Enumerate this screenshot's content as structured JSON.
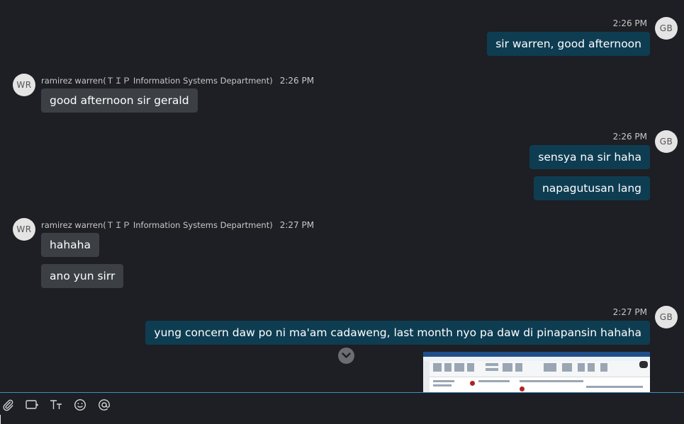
{
  "messages": [
    {
      "sender_initials": "GB",
      "time": "2:26 PM",
      "bubbles": [
        "sir warren, good afternoon"
      ]
    },
    {
      "sender_initials": "WR",
      "sender_name": "ramirez warren(ＴＩＰ Information Systems Department)",
      "time": "2:26 PM",
      "bubbles": [
        "good afternoon sir gerald"
      ]
    },
    {
      "sender_initials": "GB",
      "time": "2:26 PM",
      "bubbles": [
        "sensya na sir haha",
        "napagutusan lang"
      ]
    },
    {
      "sender_initials": "WR",
      "sender_name": "ramirez warren(ＴＩＰ Information Systems Department)",
      "time": "2:27 PM",
      "bubbles": [
        "hahaha",
        "ano yun sirr"
      ]
    },
    {
      "sender_initials": "GB",
      "time": "2:27 PM",
      "bubbles": [
        "yung concern daw po ni ma'am cadaweng, last month nyo pa daw di pinapansin hahaha"
      ],
      "attachment": "screenshot-image"
    }
  ],
  "composer": {
    "tools": [
      "paperclip-icon",
      "gif-icon",
      "text-format-icon",
      "emoji-icon",
      "mention-icon"
    ]
  },
  "colors": {
    "background": "#1d1f24",
    "outgoing_bubble": "#0e3d52",
    "incoming_bubble": "#3c3f44",
    "divider": "#3e8fbf"
  }
}
